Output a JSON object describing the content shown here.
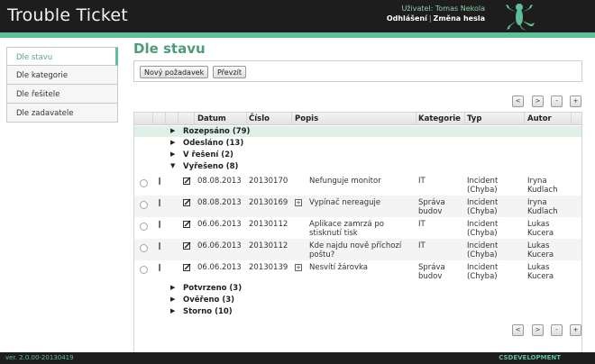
{
  "header": {
    "app_title": "Trouble Ticket",
    "user_line": "Uživatel: Tomas Nekola",
    "logout_label": "Odhlášení",
    "separator": "|",
    "change_password_label": "Změna hesla"
  },
  "sidebar": {
    "items": [
      {
        "label": "Dle stavu",
        "active": true
      },
      {
        "label": "Dle kategorie",
        "active": false
      },
      {
        "label": "Dle řešitele",
        "active": false
      },
      {
        "label": "Dle zadavatele",
        "active": false
      }
    ]
  },
  "main": {
    "title": "Dle stavu",
    "toolbar": {
      "new_request_label": "Nový požadavek",
      "take_over_label": "Převzít"
    },
    "pager": {
      "prev": "<",
      "next": ">",
      "minus": "-",
      "plus": "+"
    },
    "columns": {
      "datum": "Datum",
      "cislo": "Číslo",
      "popis": "Popis",
      "kategorie": "Kategorie",
      "typ": "Typ",
      "autor": "Autor"
    },
    "groups_before": [
      {
        "label": "Rozepsáno (79)",
        "expanded": false,
        "selected": true
      },
      {
        "label": "Odesláno (13)",
        "expanded": false,
        "selected": false
      },
      {
        "label": "V řešení (2)",
        "expanded": false,
        "selected": false
      },
      {
        "label": "Vyřešeno (8)",
        "expanded": true,
        "selected": false
      }
    ],
    "rows": [
      {
        "datum": "08.08.2013",
        "cislo": "20130170",
        "has_plus": false,
        "popis1": "Nefunguje monitor",
        "popis2": "",
        "kat1": "IT",
        "kat2": "",
        "typ1": "Incident",
        "typ2": "(Chyba)",
        "autor1": "Iryna",
        "autor2": "Kudlach"
      },
      {
        "datum": "08.08.2013",
        "cislo": "20130169",
        "has_plus": true,
        "popis1": "Vypínač nereaguje",
        "popis2": "",
        "kat1": "Správa",
        "kat2": "budov",
        "typ1": "Incident",
        "typ2": "(Chyba)",
        "autor1": "Iryna",
        "autor2": "Kudlach"
      },
      {
        "datum": "06.06.2013",
        "cislo": "20130112",
        "has_plus": false,
        "popis1": "Aplikace zamrzá po",
        "popis2": "stisknutí tisk",
        "kat1": "IT",
        "kat2": "",
        "typ1": "Incident",
        "typ2": "(Chyba)",
        "autor1": "Lukas",
        "autor2": "Kucera"
      },
      {
        "datum": "06.06.2013",
        "cislo": "20130112",
        "has_plus": false,
        "popis1": "Kde najdu nově příchozí",
        "popis2": "poštu?",
        "kat1": "IT",
        "kat2": "",
        "typ1": "Incident",
        "typ2": "(Chyba)",
        "autor1": "Lukas",
        "autor2": "Kucera"
      },
      {
        "datum": "06.06.2013",
        "cislo": "20130139",
        "has_plus": true,
        "popis1": "Nesvítí žárovka",
        "popis2": "",
        "kat1": "Správa",
        "kat2": "budov",
        "typ1": "Incident",
        "typ2": "(Chyba)",
        "autor1": "Lukas",
        "autor2": "Kucera"
      }
    ],
    "groups_after": [
      {
        "label": "Potvrzeno (3)",
        "expanded": false
      },
      {
        "label": "Ověřeno (3)",
        "expanded": false
      },
      {
        "label": "Storno (10)",
        "expanded": false
      }
    ]
  },
  "footer": {
    "version": "ver. 2.0.00-20130419",
    "brand": "CSDEVELOPMENT"
  },
  "colors": {
    "accent": "#5fbf96",
    "header_bg": "#1d1d1d",
    "title_green": "#4e9b79"
  }
}
